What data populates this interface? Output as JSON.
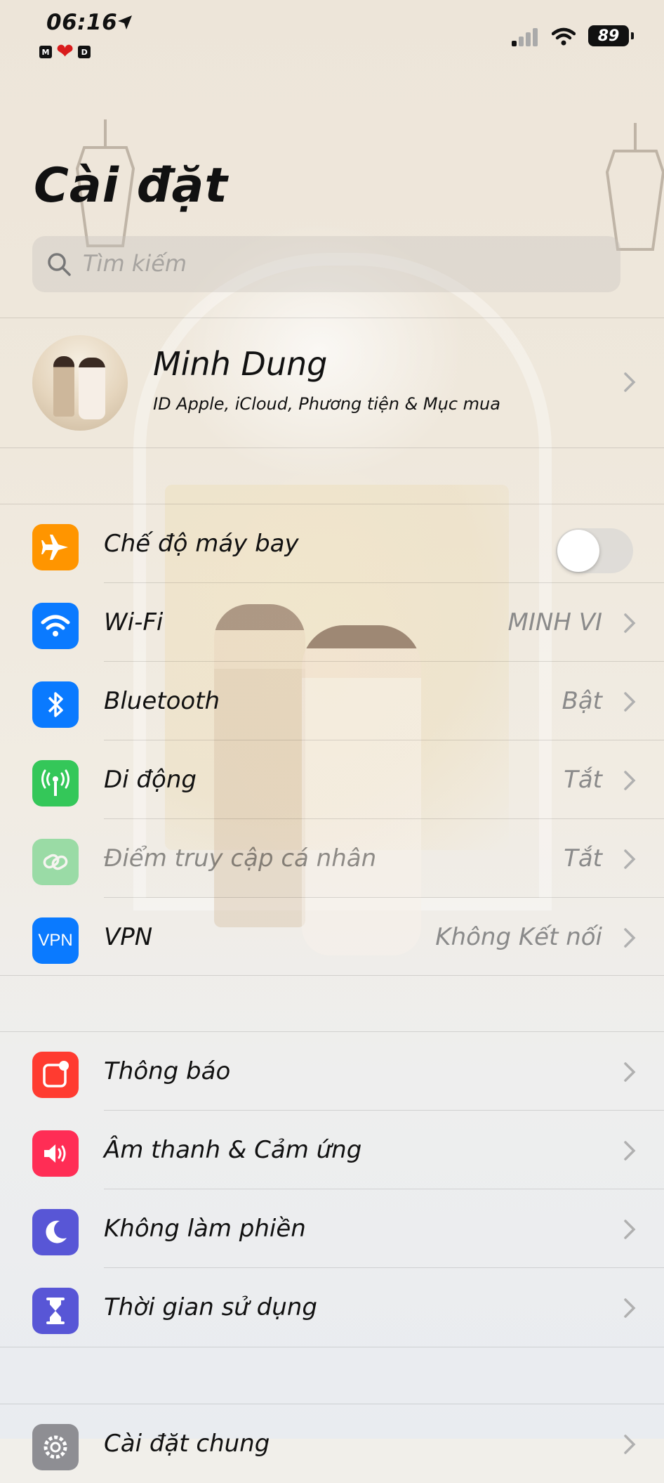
{
  "status": {
    "time": "06:16",
    "battery": "89",
    "badge_left": "M",
    "badge_right": "D"
  },
  "title": "Cài đặt",
  "search": {
    "placeholder": "Tìm kiếm"
  },
  "profile": {
    "name": "Minh Dung",
    "subtitle": "ID Apple, iCloud, Phương tiện & Mục mua"
  },
  "connectivity": [
    {
      "label": "Chế độ máy bay",
      "value": "",
      "icon": "airplane-icon",
      "color": "#ff9500",
      "toggle": false
    },
    {
      "label": "Wi-Fi",
      "value": "MINH VI",
      "icon": "wifi-icon",
      "color": "#0a7aff"
    },
    {
      "label": "Bluetooth",
      "value": "Bật",
      "icon": "bluetooth-icon",
      "color": "#0a7aff"
    },
    {
      "label": "Di động",
      "value": "Tắt",
      "icon": "cellular-icon",
      "color": "#34c759"
    },
    {
      "label": "Điểm truy cập cá nhân",
      "value": "Tắt",
      "icon": "hotspot-icon",
      "color": "#34c759",
      "disabled": true
    },
    {
      "label": "VPN",
      "value": "Không Kết nối",
      "icon": "vpn-icon",
      "color": "#0a7aff",
      "icon_text": "VPN"
    }
  ],
  "notifications": [
    {
      "label": "Thông báo",
      "icon": "notifications-icon",
      "color": "#ff3b30"
    },
    {
      "label": "Âm thanh & Cảm ứng",
      "icon": "sound-icon",
      "color": "#ff2d55"
    },
    {
      "label": "Không làm phiền",
      "icon": "moon-icon",
      "color": "#5856d6"
    },
    {
      "label": "Thời gian sử dụng",
      "icon": "hourglass-icon",
      "color": "#5856d6"
    }
  ],
  "general": [
    {
      "label": "Cài đặt chung",
      "icon": "gear-icon",
      "color": "#8e8e93"
    }
  ]
}
